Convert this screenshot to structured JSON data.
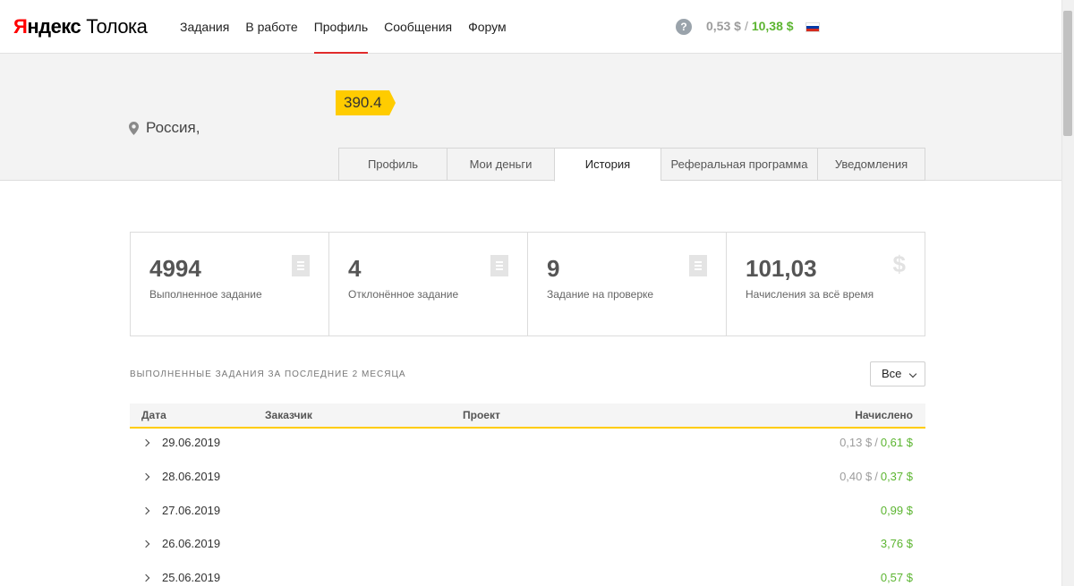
{
  "header": {
    "logo_ya": "Яндекс",
    "logo_toloka": "Толока",
    "nav": [
      {
        "label": "Задания",
        "active": false
      },
      {
        "label": "В работе",
        "active": false
      },
      {
        "label": "Профиль",
        "active": true
      },
      {
        "label": "Сообщения",
        "active": false
      },
      {
        "label": "Форум",
        "active": false
      }
    ],
    "help": "?",
    "balance_pending": "0,53 $",
    "balance_separator": "/",
    "balance_available": "10,38 $",
    "flag_colors": [
      "#ffffff",
      "#0039a6",
      "#d52b1e"
    ]
  },
  "profile": {
    "rating": "390.4",
    "location": "Россия,",
    "tabs": [
      {
        "label": "Профиль",
        "active": false
      },
      {
        "label": "Мои деньги",
        "active": false
      },
      {
        "label": "История",
        "active": true
      },
      {
        "label": "Реферальная программа",
        "active": false
      },
      {
        "label": "Уведомления",
        "active": false
      }
    ]
  },
  "stats": [
    {
      "value": "4994",
      "label": "Выполненное задание",
      "icon": "document-icon"
    },
    {
      "value": "4",
      "label": "Отклонённое задание",
      "icon": "document-icon"
    },
    {
      "value": "9",
      "label": "Задание на проверке",
      "icon": "document-icon"
    },
    {
      "value": "101,03",
      "label": "Начисления за всё время",
      "icon": "dollar-icon",
      "glyph": "$"
    }
  ],
  "history": {
    "title": "ВЫПОЛНЕННЫЕ ЗАДАНИЯ ЗА ПОСЛЕДНИЕ 2 МЕСЯЦА",
    "filter_value": "Все",
    "columns": {
      "date": "Дата",
      "requester": "Заказчик",
      "project": "Проект",
      "earned": "Начислено"
    },
    "rows": [
      {
        "date": "29.06.2019",
        "pending": "0,13 $",
        "sep": "/",
        "earned": "0,61 $"
      },
      {
        "date": "28.06.2019",
        "pending": "0,40 $",
        "sep": "/",
        "earned": "0,37 $"
      },
      {
        "date": "27.06.2019",
        "pending": "",
        "sep": "",
        "earned": "0,99 $"
      },
      {
        "date": "26.06.2019",
        "pending": "",
        "sep": "",
        "earned": "3,76 $"
      },
      {
        "date": "25.06.2019",
        "pending": "",
        "sep": "",
        "earned": "0,57 $"
      }
    ]
  },
  "colors": {
    "accent_yellow": "#ffcc00",
    "money_green": "#5cb531",
    "nav_active_red": "#e02b2b"
  }
}
